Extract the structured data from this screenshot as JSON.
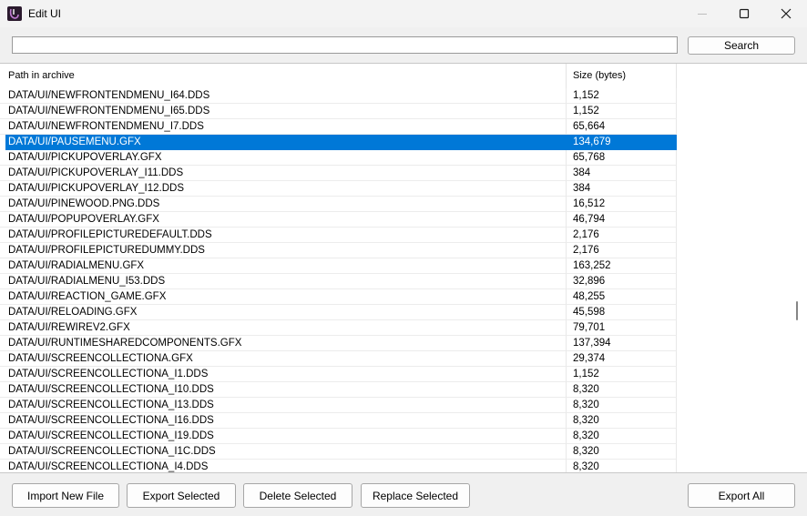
{
  "window": {
    "title": "Edit UI",
    "icons": {
      "app": "app-icon",
      "minimize": "minimize-icon",
      "maximize": "maximize-icon",
      "close": "close-icon"
    }
  },
  "search": {
    "value": "",
    "placeholder": "",
    "button_label": "Search"
  },
  "table": {
    "columns": [
      "Path in archive",
      "Size (bytes)"
    ],
    "selected_index": 3,
    "rows": [
      {
        "path": "DATA/UI/NEWFRONTENDMENU_I64.DDS",
        "size": "1,152"
      },
      {
        "path": "DATA/UI/NEWFRONTENDMENU_I65.DDS",
        "size": "1,152"
      },
      {
        "path": "DATA/UI/NEWFRONTENDMENU_I7.DDS",
        "size": "65,664"
      },
      {
        "path": "DATA/UI/PAUSEMENU.GFX",
        "size": "134,679"
      },
      {
        "path": "DATA/UI/PICKUPOVERLAY.GFX",
        "size": "65,768"
      },
      {
        "path": "DATA/UI/PICKUPOVERLAY_I11.DDS",
        "size": "384"
      },
      {
        "path": "DATA/UI/PICKUPOVERLAY_I12.DDS",
        "size": "384"
      },
      {
        "path": "DATA/UI/PINEWOOD.PNG.DDS",
        "size": "16,512"
      },
      {
        "path": "DATA/UI/POPUPOVERLAY.GFX",
        "size": "46,794"
      },
      {
        "path": "DATA/UI/PROFILEPICTUREDEFAULT.DDS",
        "size": "2,176"
      },
      {
        "path": "DATA/UI/PROFILEPICTUREDUMMY.DDS",
        "size": "2,176"
      },
      {
        "path": "DATA/UI/RADIALMENU.GFX",
        "size": "163,252"
      },
      {
        "path": "DATA/UI/RADIALMENU_I53.DDS",
        "size": "32,896"
      },
      {
        "path": "DATA/UI/REACTION_GAME.GFX",
        "size": "48,255"
      },
      {
        "path": "DATA/UI/RELOADING.GFX",
        "size": "45,598"
      },
      {
        "path": "DATA/UI/REWIREV2.GFX",
        "size": "79,701"
      },
      {
        "path": "DATA/UI/RUNTIMESHAREDCOMPONENTS.GFX",
        "size": "137,394"
      },
      {
        "path": "DATA/UI/SCREENCOLLECTIONA.GFX",
        "size": "29,374"
      },
      {
        "path": "DATA/UI/SCREENCOLLECTIONA_I1.DDS",
        "size": "1,152"
      },
      {
        "path": "DATA/UI/SCREENCOLLECTIONA_I10.DDS",
        "size": "8,320"
      },
      {
        "path": "DATA/UI/SCREENCOLLECTIONA_I13.DDS",
        "size": "8,320"
      },
      {
        "path": "DATA/UI/SCREENCOLLECTIONA_I16.DDS",
        "size": "8,320"
      },
      {
        "path": "DATA/UI/SCREENCOLLECTIONA_I19.DDS",
        "size": "8,320"
      },
      {
        "path": "DATA/UI/SCREENCOLLECTIONA_I1C.DDS",
        "size": "8,320"
      },
      {
        "path": "DATA/UI/SCREENCOLLECTIONA_I4.DDS",
        "size": "8,320"
      }
    ]
  },
  "buttons": {
    "import": "Import New File",
    "export_selected": "Export Selected",
    "delete_selected": "Delete Selected",
    "replace_selected": "Replace Selected",
    "export_all": "Export All"
  },
  "colors": {
    "selection": "#0078d7",
    "app_icon_bg": "#2b1a2e",
    "app_icon_fg": "#c07ad0"
  }
}
